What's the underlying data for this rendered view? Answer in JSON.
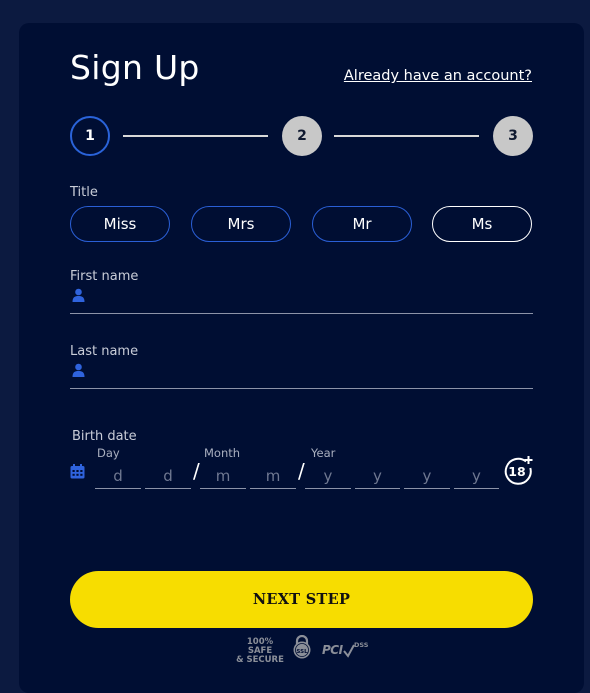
{
  "header": {
    "title": "Sign Up",
    "login_link": "Already have an account?"
  },
  "stepper": {
    "steps": [
      "1",
      "2",
      "3"
    ],
    "active_step": 1
  },
  "title_field": {
    "label": "Title",
    "options": [
      "Miss",
      "Mrs",
      "Mr",
      "Ms"
    ],
    "selected": "Ms"
  },
  "first_name": {
    "label": "First name",
    "icon": "user-icon",
    "value": ""
  },
  "last_name": {
    "label": "Last name",
    "icon": "user-icon",
    "value": ""
  },
  "birth_date": {
    "label": "Birth date",
    "icon": "calendar-icon",
    "day_label": "Day",
    "month_label": "Month",
    "year_label": "Year",
    "day_placeholders": [
      "d",
      "d"
    ],
    "month_placeholders": [
      "m",
      "m"
    ],
    "year_placeholders": [
      "y",
      "y",
      "y",
      "y"
    ],
    "separator": "/",
    "age_badge": "18+"
  },
  "footer": {
    "next_button": "NEXT STEP",
    "badge_safe_line1": "100% SAFE",
    "badge_safe_line2": "& SECURE",
    "badge_ssl": "SSL",
    "badge_pci": "PCI",
    "badge_dss": "DSS"
  },
  "colors": {
    "background": "#0c1a40",
    "panel": "#000e33",
    "accent_blue": "#2a63d9",
    "button_yellow": "#f7dd00"
  }
}
